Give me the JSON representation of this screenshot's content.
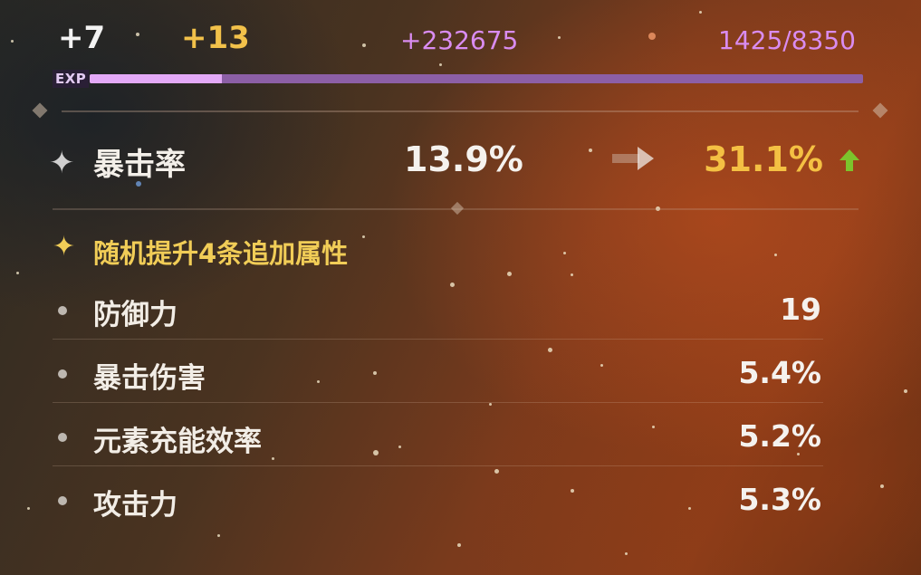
{
  "level": {
    "current": "+7",
    "target": "+13"
  },
  "exp": {
    "gain": "+232675",
    "progress_text": "1425/8350",
    "label": "EXP",
    "fill_fraction": 0.171
  },
  "main_stat": {
    "name": "暴击率",
    "before": "13.9%",
    "after": "31.1%"
  },
  "substats_header": "随机提升4条追加属性",
  "substats": [
    {
      "name": "防御力",
      "value": "19"
    },
    {
      "name": "暴击伤害",
      "value": "5.4%"
    },
    {
      "name": "元素充能效率",
      "value": "5.2%"
    },
    {
      "name": "攻击力",
      "value": "5.3%"
    }
  ],
  "icons": {
    "main_stat": "sparkle-icon",
    "substat_header": "sparkle-icon",
    "transition": "right-arrow-icon",
    "increase": "up-arrow-icon",
    "substat_bullet": "bullet-dot-icon"
  },
  "colors": {
    "accent_gold": "#f4c043",
    "exp_purple": "#d98cf0",
    "increase_green": "#7cc42c",
    "text_white": "#f5f2ee"
  }
}
